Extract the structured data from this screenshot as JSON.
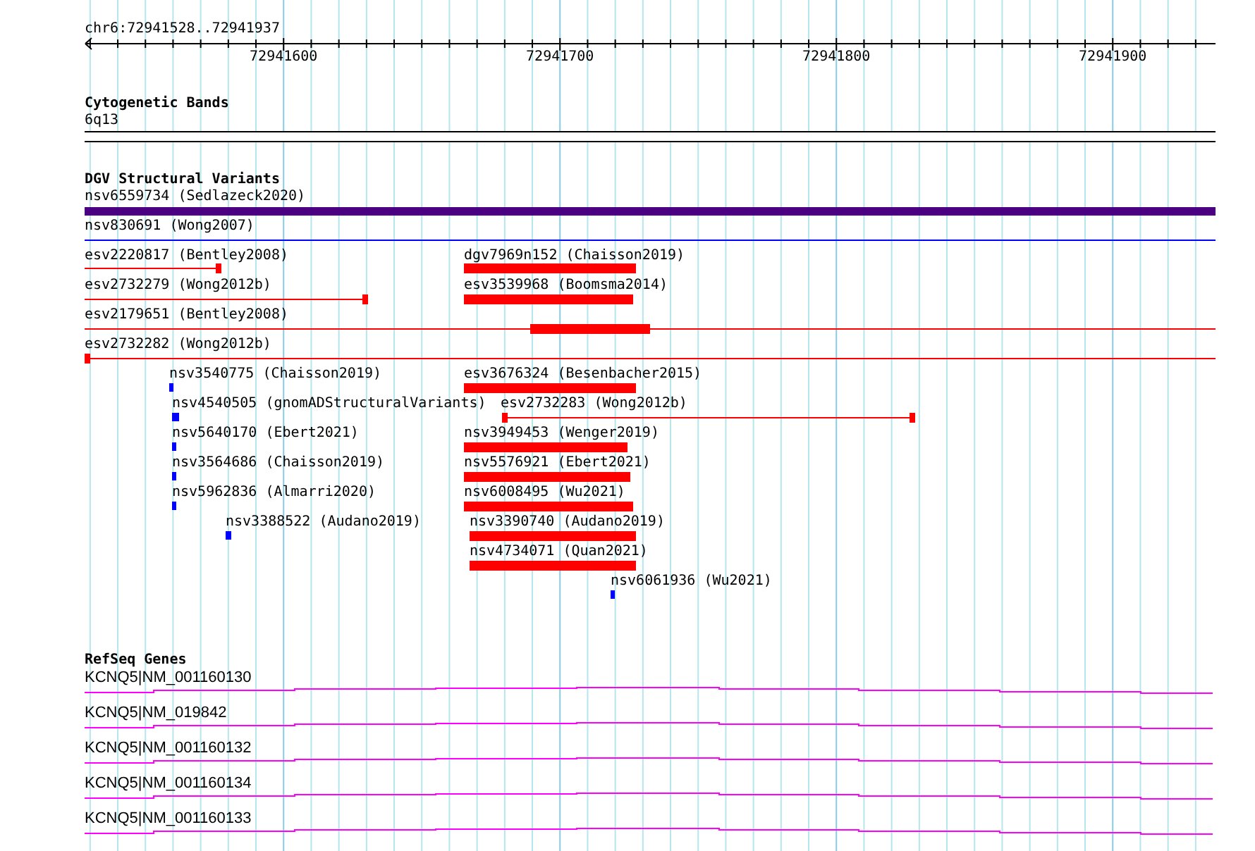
{
  "ruler": {
    "range": "chr6:72941528..72941937",
    "ticks": [
      "72941600",
      "72941700",
      "72941800",
      "72941900"
    ]
  },
  "cytogenetic_bands": {
    "title": "Cytogenetic Bands",
    "bands": [
      {
        "label": "6q13"
      }
    ]
  },
  "dgv_structural_variants": {
    "title": "DGV Structural Variants",
    "variants": [
      {
        "label": "nsv6559734 (Sedlazeck2020)",
        "kind": "bar",
        "color": "#4b0082"
      },
      {
        "label": "nsv830691 (Wong2007)",
        "kind": "line",
        "color": "#0000ff"
      },
      {
        "label": "esv2220817 (Bentley2008)",
        "kind": "line",
        "color": "#ff0000"
      },
      {
        "label": "dgv7969n152 (Chaisson2019)",
        "kind": "bar",
        "color": "#ff0000"
      },
      {
        "label": "esv2732279 (Wong2012b)",
        "kind": "line",
        "color": "#ff0000"
      },
      {
        "label": "esv3539968 (Boomsma2014)",
        "kind": "bar",
        "color": "#ff0000"
      },
      {
        "label": "esv2179651 (Bentley2008)",
        "kind": "line",
        "color": "#ff0000"
      },
      {
        "label": "esv2732282 (Wong2012b)",
        "kind": "line",
        "color": "#ff0000"
      },
      {
        "label": "nsv3540775 (Chaisson2019)",
        "kind": "point",
        "color": "#0000ff"
      },
      {
        "label": "esv3676324 (Besenbacher2015)",
        "kind": "bar",
        "color": "#ff0000"
      },
      {
        "label": "nsv4540505 (gnomADStructuralVariants)",
        "kind": "point",
        "color": "#0000ff"
      },
      {
        "label": "esv2732283 (Wong2012b)",
        "kind": "line",
        "color": "#ff0000"
      },
      {
        "label": "nsv5640170 (Ebert2021)",
        "kind": "point",
        "color": "#0000ff"
      },
      {
        "label": "nsv3949453 (Wenger2019)",
        "kind": "bar",
        "color": "#ff0000"
      },
      {
        "label": "nsv3564686 (Chaisson2019)",
        "kind": "point",
        "color": "#0000ff"
      },
      {
        "label": "nsv5576921 (Ebert2021)",
        "kind": "bar",
        "color": "#ff0000"
      },
      {
        "label": "nsv5962836 (Almarri2020)",
        "kind": "point",
        "color": "#0000ff"
      },
      {
        "label": "nsv6008495 (Wu2021)",
        "kind": "bar",
        "color": "#ff0000"
      },
      {
        "label": "nsv3388522 (Audano2019)",
        "kind": "point",
        "color": "#0000ff"
      },
      {
        "label": "nsv3390740 (Audano2019)",
        "kind": "bar",
        "color": "#ff0000"
      },
      {
        "label": "nsv4734071 (Quan2021)",
        "kind": "bar",
        "color": "#ff0000"
      },
      {
        "label": "nsv6061936 (Wu2021)",
        "kind": "point",
        "color": "#0000ff"
      }
    ]
  },
  "refseq_genes": {
    "title": "RefSeq Genes",
    "genes": [
      {
        "label": "KCNQ5|NM_001160130"
      },
      {
        "label": "KCNQ5|NM_019842"
      },
      {
        "label": "KCNQ5|NM_001160132"
      },
      {
        "label": "KCNQ5|NM_001160134"
      },
      {
        "label": "KCNQ5|NM_001160133"
      }
    ]
  }
}
